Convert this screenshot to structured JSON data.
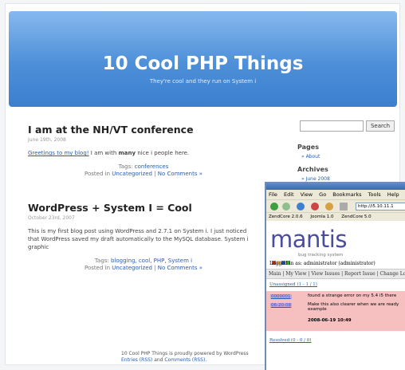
{
  "blog": {
    "title": "10 Cool PHP Things",
    "description": "They're cool and they run on System i",
    "posts": [
      {
        "title": "I am at the NH/VT conference",
        "date": "June 19th, 2008",
        "body_link": "Greetings to my blog!",
        "body_pre": "I am with",
        "body_bold": "many",
        "body_post": "nice i people here.",
        "tags_label": "Tags:",
        "tags": "conferences",
        "posted_in": "Posted in",
        "category": "Uncategorized",
        "comments": "No Comments »"
      },
      {
        "title": "WordPress + System I = Cool",
        "date": "October 23rd, 2007",
        "body": "This is my first blog post using WordPress and 2.7.1 on System i. I just noticed that WordPress saved my draft automatically to the MySQL database. System i graphic",
        "tags_label": "Tags:",
        "tags": "blogging, cool, PHP, System i",
        "posted_in": "Posted in",
        "category": "Uncategorized",
        "comments": "No Comments »"
      }
    ],
    "sidebar": {
      "search_button": "Search",
      "pages_heading": "Pages",
      "pages_link": "About",
      "archives_heading": "Archives",
      "archives_link": "June 2008"
    },
    "footer": {
      "line1": "10 Cool PHP Things is proudly powered by WordPress",
      "line2_a": "Entries (RSS)",
      "line2_and": "and",
      "line2_b": "Comments (RSS)."
    }
  },
  "browser": {
    "menu": [
      "File",
      "Edit",
      "View",
      "Go",
      "Bookmarks",
      "Tools",
      "Help"
    ],
    "url": "http://i5.10.11.1",
    "bookmarks": [
      "ZendCore 2.0.6",
      "Joomla 1.0",
      "ZendCore 5.0"
    ],
    "mantis": {
      "logo": "mantis",
      "tagline": "bug tracking system",
      "logged_in": "Logged in as: administrator (administrator)",
      "date_text": "06-20-08",
      "nav": "Main | My View | View Issues | Report Issue | Change Log",
      "unassigned": "Unassigned (1 - 1 / 1)",
      "issue_id": "0000001",
      "issue_summary": "found a strange error on my 5.4 i5 there",
      "issue_detail": "Make this also clearer when we are ready example",
      "issue_date": "2008-06-19 10:49",
      "resolved": "Resolved (0 - 0 / 0)"
    }
  }
}
